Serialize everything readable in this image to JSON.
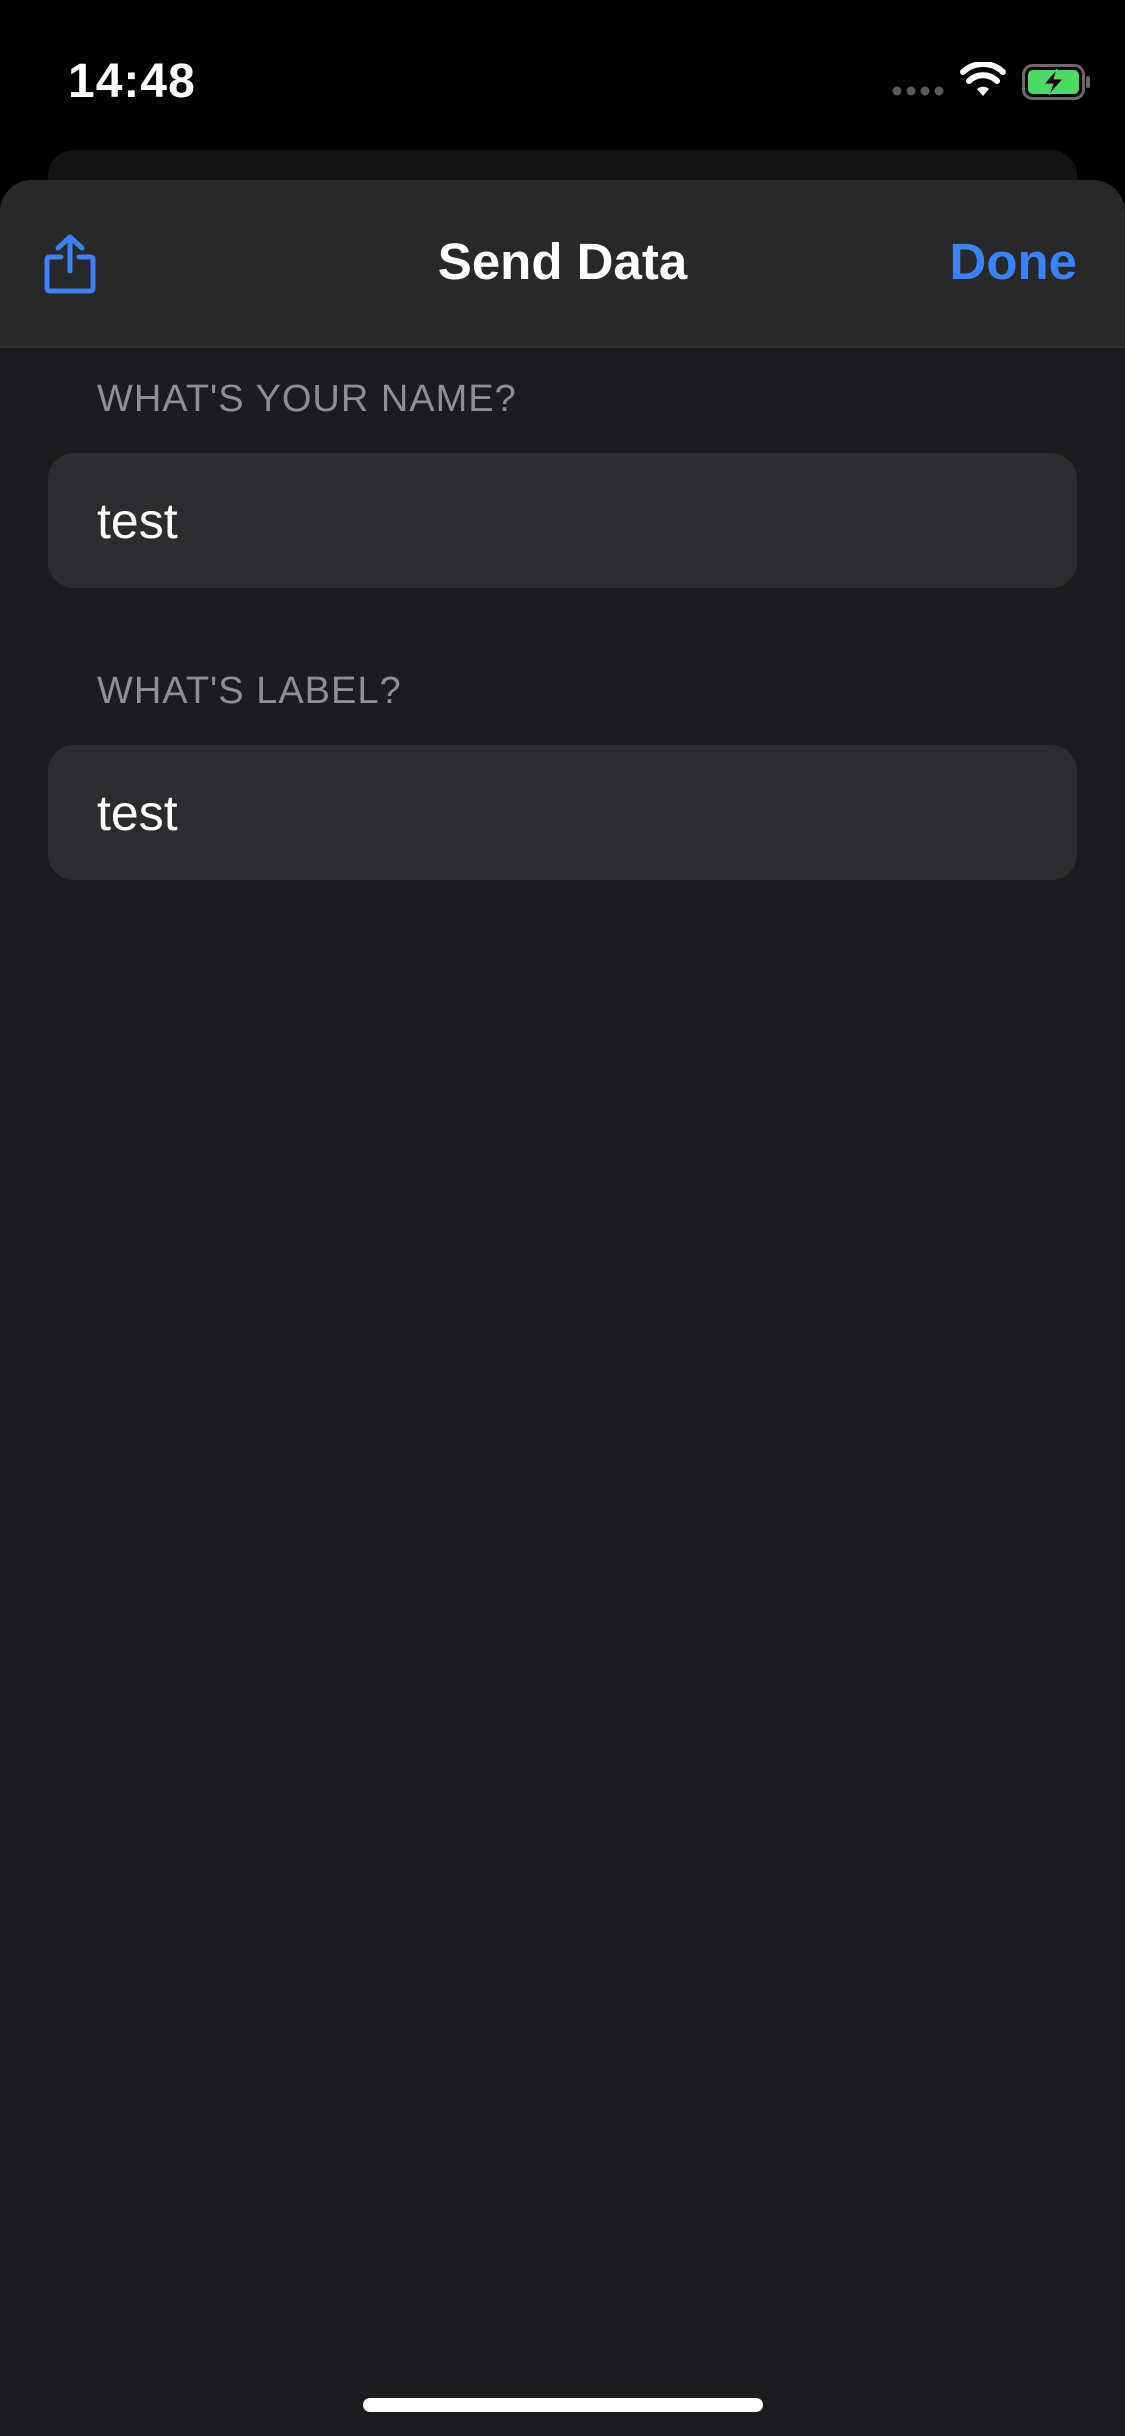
{
  "status_bar": {
    "time": "14:48",
    "icons": [
      "cellular-dots-icon",
      "wifi-icon",
      "battery-charging-icon"
    ],
    "battery_color": "#4cd964"
  },
  "nav": {
    "title": "Send Data",
    "done_label": "Done",
    "left_icon": "share-icon",
    "accent_color": "#3a82f7"
  },
  "form": {
    "fields": [
      {
        "label": "WHAT'S YOUR NAME?",
        "value": "test"
      },
      {
        "label": "WHAT'S LABEL?",
        "value": "test"
      }
    ]
  }
}
